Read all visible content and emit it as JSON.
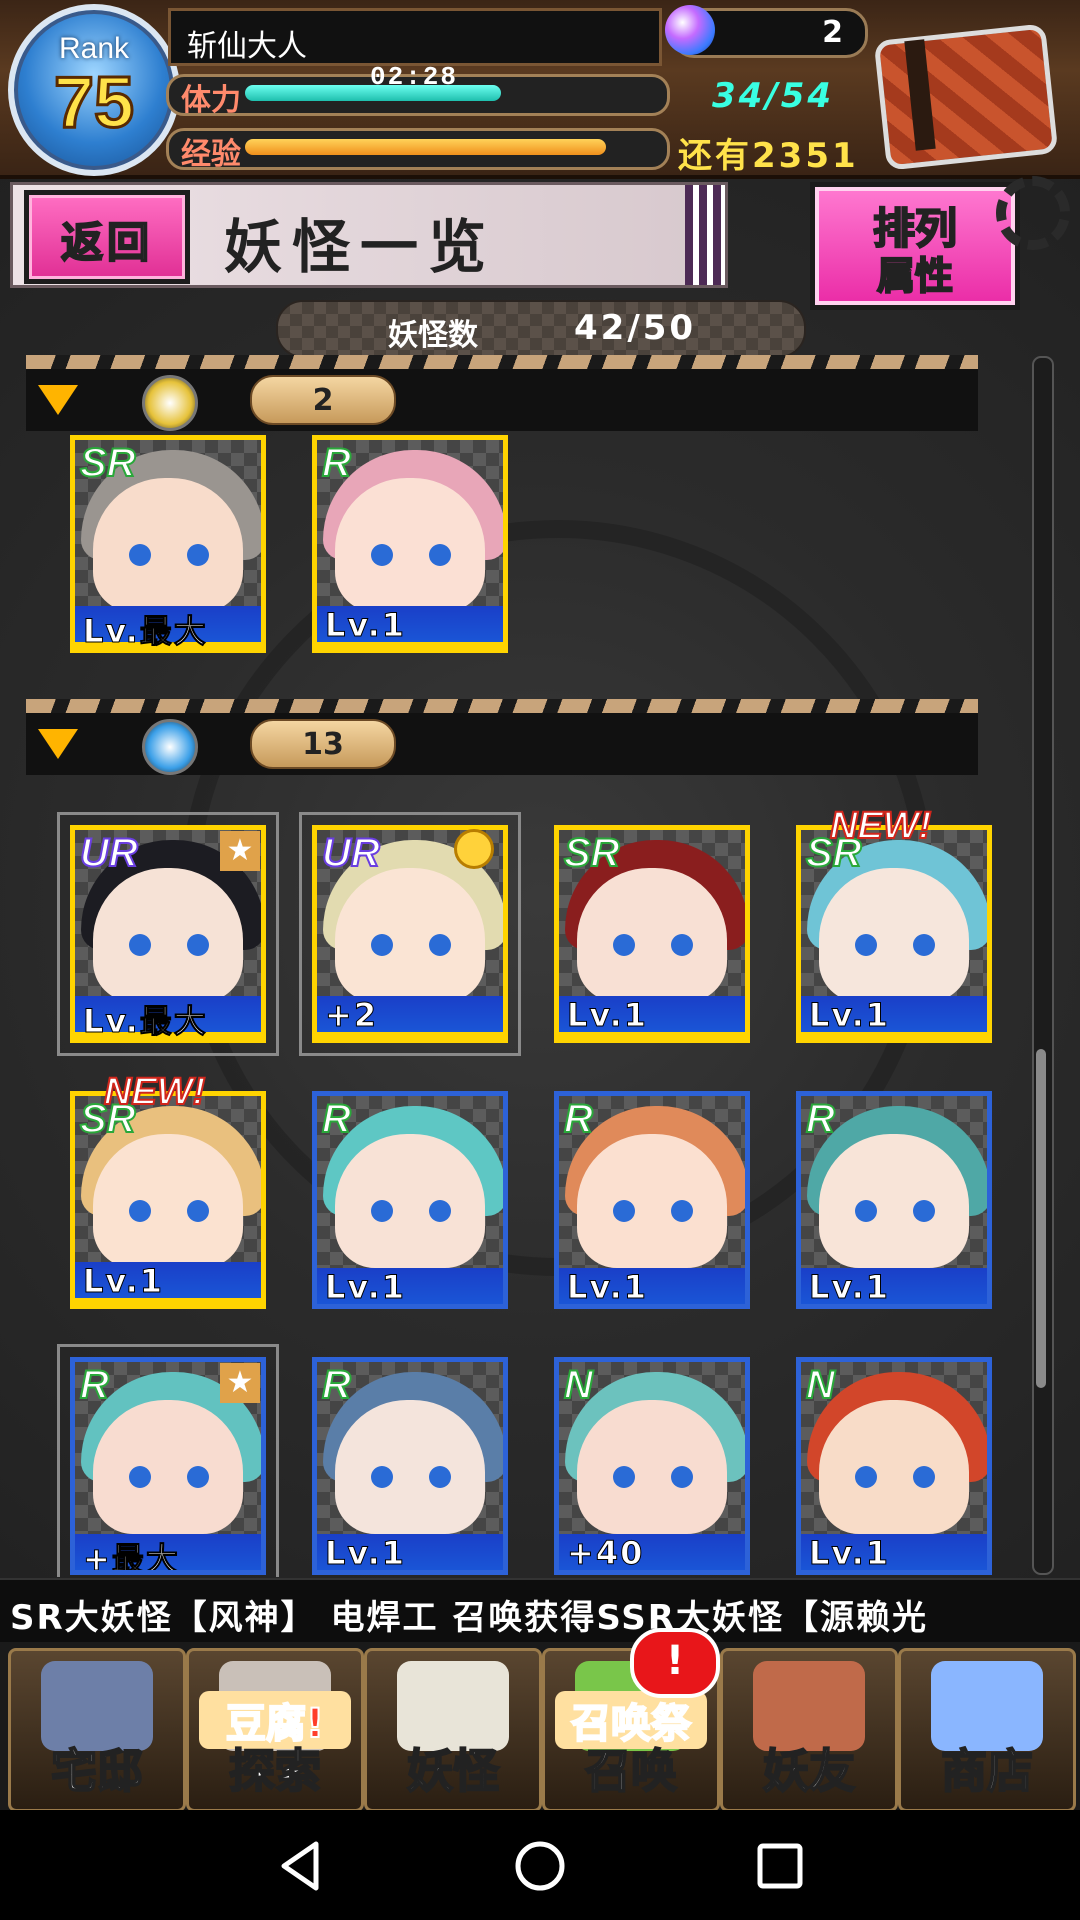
{
  "player": {
    "rank_label": "Rank",
    "rank": "75",
    "name": "斩仙大人",
    "stamina_label": "体力",
    "stamina_timer": "02:28",
    "stamina_value": "34/54",
    "stamina_fraction": 0.63,
    "exp_label": "经验",
    "exp_remaining": "还有2351",
    "exp_fraction": 0.89,
    "gems": "2"
  },
  "header": {
    "back_label": "返回",
    "title": "妖怪一览",
    "sort_line1": "排列",
    "sort_line2": "属性"
  },
  "count": {
    "label": "妖怪数",
    "value": "42/50"
  },
  "scroll_fraction": 0.22,
  "groups": [
    {
      "attribute_icon": "gold-element-icon",
      "attribute_color": "#e6c23a",
      "count": "2",
      "cards": [
        {
          "rarity": "SR",
          "level": "Lv.最大",
          "hair": "#9a9590",
          "skin": "#f8dccb",
          "gold": true
        },
        {
          "rarity": "R",
          "level": "Lv.1",
          "hair": "#e8a6b8",
          "skin": "#fbe0d4",
          "gold": true
        }
      ]
    },
    {
      "attribute_icon": "water-element-icon",
      "attribute_color": "#3a9fe8",
      "count": "13",
      "cards": [
        {
          "rarity": "UR",
          "level": "Lv.最大",
          "hair": "#1c1c22",
          "skin": "#f6e2d6",
          "star": true,
          "selected": true,
          "gold": true
        },
        {
          "rarity": "UR",
          "level": "+2",
          "hair": "#e2dbb0",
          "skin": "#fae4d4",
          "medal": true,
          "selected": true,
          "gold": true
        },
        {
          "rarity": "SR",
          "level": "Lv.1",
          "hair": "#8a1e1e",
          "skin": "#f8e0d4",
          "gold": true
        },
        {
          "rarity": "SR",
          "level": "Lv.1",
          "hair": "#6fc4d6",
          "skin": "#f6e6dc",
          "new": "NEW!",
          "gold": true
        },
        {
          "rarity": "SR",
          "level": "Lv.1",
          "hair": "#e9c07e",
          "skin": "#fbe2d0",
          "new": "NEW!",
          "gold": true
        },
        {
          "rarity": "R",
          "level": "Lv.1",
          "hair": "#5ec7c4",
          "skin": "#f8e2d6"
        },
        {
          "rarity": "R",
          "level": "Lv.1",
          "hair": "#e08a5a",
          "skin": "#fbe0d0"
        },
        {
          "rarity": "R",
          "level": "Lv.1",
          "hair": "#4fa8a6",
          "skin": "#f8e4d8"
        },
        {
          "rarity": "R",
          "level": "+最大",
          "hair": "#62c2c0",
          "skin": "#f8dcd0",
          "star": true,
          "selected": true
        },
        {
          "rarity": "R",
          "level": "Lv.1",
          "hair": "#5a7ea8",
          "skin": "#f4e4dc"
        },
        {
          "rarity": "N",
          "level": "+40",
          "hair": "#6cc2be",
          "skin": "#f8dcd0"
        },
        {
          "rarity": "N",
          "level": "Lv.1",
          "hair": "#d2462a",
          "skin": "#f8dcc8"
        }
      ]
    }
  ],
  "ticker": "SR大妖怪【风神】  电焊工 召唤获得SSR大妖怪【源赖光",
  "nav": [
    {
      "label": "宅邸",
      "icon": "mansion-icon",
      "color": "#6d7fa8"
    },
    {
      "label": "探索",
      "icon": "explore-icon",
      "color": "#c9c0b8",
      "sub": "豆腐!"
    },
    {
      "label": "妖怪",
      "icon": "yokai-scroll-icon",
      "color": "#e8e4d8"
    },
    {
      "label": "召唤",
      "icon": "summon-icon",
      "color": "#79c64a",
      "sub": "召唤祭"
    },
    {
      "label": "妖友",
      "icon": "friend-icon",
      "color": "#c06a4a"
    },
    {
      "label": "商店",
      "icon": "shop-orb-icon",
      "color": "#8ab6ff"
    }
  ],
  "alert": "!"
}
